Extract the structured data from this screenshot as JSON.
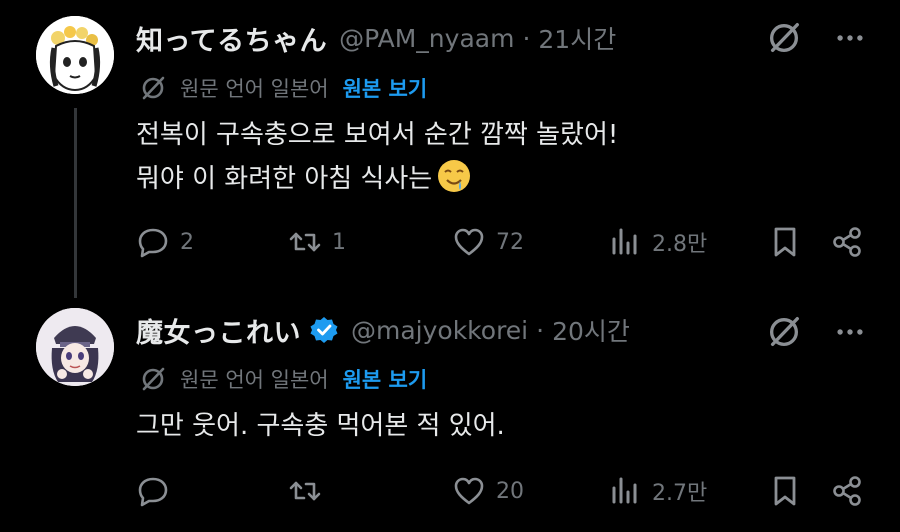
{
  "posts": [
    {
      "display_name": "知ってるちゃん",
      "handle": "@PAM_nyaam",
      "separator": "·",
      "time": "21시간",
      "translation": {
        "label": "원문 언어 일본어",
        "link": "원본 보기"
      },
      "content_lines": [
        "전복이 구속충으로 보여서 순간 깜짝 놀랐어!",
        "뭐야 이 화려한 아침 식사는"
      ],
      "emoji": "drooling-face-emoji",
      "verified": false,
      "actions": {
        "replies": "2",
        "reposts": "1",
        "likes": "72",
        "views": "2.8만"
      }
    },
    {
      "display_name": "魔女っこれい",
      "handle": "@majyokkorei",
      "separator": "·",
      "time": "20시간",
      "translation": {
        "label": "원문 언어 일본어",
        "link": "원본 보기"
      },
      "content_lines": [
        "그만 웃어. 구속충 먹어본 적 있어."
      ],
      "verified": true,
      "actions": {
        "replies": "",
        "reposts": "",
        "likes": "20",
        "views": "2.7만"
      }
    }
  ],
  "icons": {
    "grok": "grok-icon",
    "more": "more-icon",
    "translate": "translate-icon",
    "reply": "reply-icon",
    "repost": "repost-icon",
    "like": "heart-icon",
    "views": "views-icon",
    "bookmark": "bookmark-icon",
    "share": "share-icon",
    "verified": "verified-badge-icon"
  },
  "colors": {
    "background": "#000000",
    "text": "#e7e9ea",
    "muted": "#71767b",
    "link": "#1d9bf0",
    "verified": "#1d9bf0"
  }
}
